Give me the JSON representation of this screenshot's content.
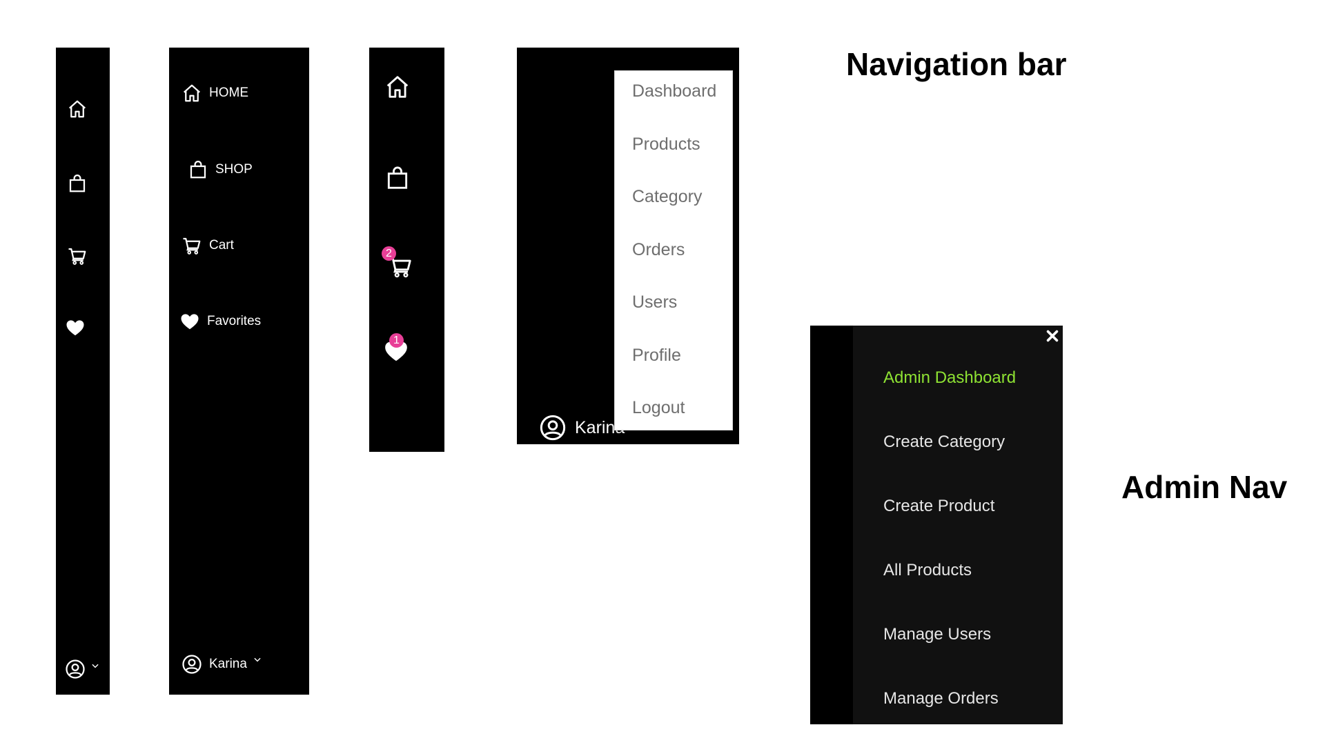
{
  "collapsed_sidebar": {
    "icons": [
      "home-icon",
      "shopping-bag-icon",
      "cart-icon",
      "heart-icon"
    ],
    "footer_icons": [
      "user-circle-icon",
      "chevron-down-icon"
    ]
  },
  "expanded_sidebar": {
    "items": [
      {
        "label": "HOME",
        "icon": "home-icon"
      },
      {
        "label": "SHOP",
        "icon": "shopping-bag-icon"
      },
      {
        "label": "Cart",
        "icon": "cart-icon"
      },
      {
        "label": "Favorites",
        "icon": "heart-icon"
      }
    ],
    "user": {
      "name": "Karina",
      "icon": "user-circle-icon",
      "toggle_icon": "chevron-down-icon"
    }
  },
  "badge_sidebar": {
    "icons": [
      "home-icon",
      "shopping-bag-icon",
      "cart-icon",
      "heart-icon"
    ],
    "cart_count": "2",
    "favorites_count": "1",
    "badge_color": "#e83f97"
  },
  "dropdown_sidebar": {
    "user_name": "Karina",
    "menu_items": [
      "Dashboard",
      "Products",
      "Category",
      "Orders",
      "Users",
      "Profile",
      "Logout"
    ]
  },
  "labels": {
    "navigation_bar": "Navigation bar",
    "admin_nav": "Admin Nav"
  },
  "admin_nav": {
    "close_icon": "close-icon",
    "items": [
      "Admin Dashboard",
      "Create Category",
      "Create Product",
      "All Products",
      "Manage Users",
      "Manage Orders"
    ],
    "active_color": "#8ee233",
    "text_color": "#e6e6e6"
  }
}
